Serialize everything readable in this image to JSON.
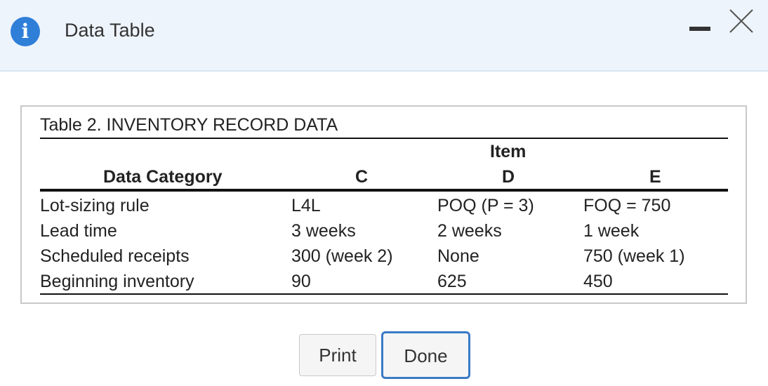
{
  "dialog": {
    "title": "Data Table",
    "info_icon": "info-icon",
    "minimize_icon": "minimize-icon",
    "close_icon": "close-icon"
  },
  "table": {
    "caption": "Table 2. INVENTORY RECORD DATA",
    "group_header": "Item",
    "columns": [
      "Data Category",
      "C",
      "D",
      "E"
    ],
    "rows": [
      [
        "Lot-sizing rule",
        "L4L",
        "POQ (P = 3)",
        "FOQ = 750"
      ],
      [
        "Lead time",
        "3 weeks",
        "2 weeks",
        "1 week"
      ],
      [
        "Scheduled receipts",
        "300 (week 2)",
        "None",
        "750 (week 1)"
      ],
      [
        "Beginning inventory",
        "90",
        "625",
        "450"
      ]
    ]
  },
  "buttons": {
    "print": "Print",
    "done": "Done"
  },
  "colors": {
    "accent": "#2f7fd9",
    "titlebar_bg": "#eef4fb",
    "done_border": "#3a7ac6"
  }
}
